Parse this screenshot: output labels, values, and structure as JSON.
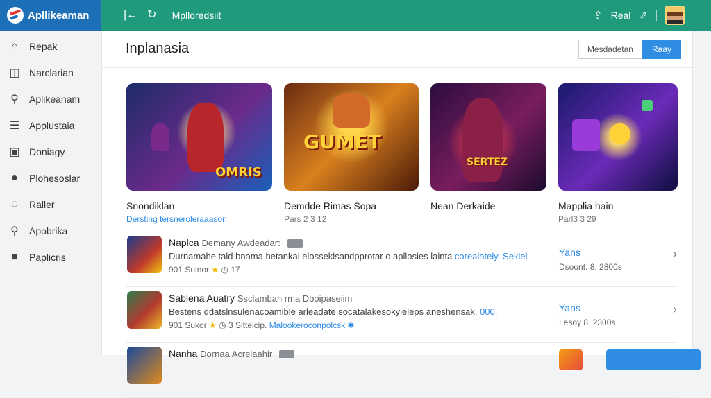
{
  "app": {
    "name": "Apllikeaman"
  },
  "topbar": {
    "title": "Mplloredsiit",
    "right_label": "Real"
  },
  "sidebar": {
    "items": [
      {
        "label": "Repak",
        "icon": "home-icon"
      },
      {
        "label": "Narclarian",
        "icon": "chart-icon"
      },
      {
        "label": "Aplikeanam",
        "icon": "search-icon"
      },
      {
        "label": "Applustaia",
        "icon": "list-icon"
      },
      {
        "label": "Doniagy",
        "icon": "wallet-icon"
      },
      {
        "label": "Plohesoslar",
        "icon": "user-icon"
      },
      {
        "label": "Raller",
        "icon": "chat-icon"
      },
      {
        "label": "Apobrika",
        "icon": "magnifier-icon"
      },
      {
        "label": "Paplicris",
        "icon": "lock-icon"
      }
    ]
  },
  "main": {
    "title": "Inplanasia",
    "secondary_button": "Mesdadetan",
    "primary_button": "Raay"
  },
  "cards": [
    {
      "name": "Snondiklan",
      "sub": "Dersting tersneroleraaason",
      "sub_is_link": true,
      "art_text": "OMRIS"
    },
    {
      "name": "Demdde Rimas Sopa",
      "sub": "Pars 2 3 12",
      "sub_is_link": false,
      "art_text": "GUMET"
    },
    {
      "name": "Nean Derkaide",
      "sub": "",
      "sub_is_link": false,
      "art_text": "SERTEZ"
    },
    {
      "name": "Mapplia hain",
      "sub": "Parl3 3 29",
      "sub_is_link": false,
      "art_text": ""
    }
  ],
  "rows": [
    {
      "title": "Naplca",
      "meta": "Demany Awdeadar:",
      "desc": "Durnamahe tald bnama hetankai elossekisandpprotar o apllosies lainta ",
      "desc_link": "corealately. Sekiel",
      "rating_text": "901 Sulnor",
      "rating_count": "17",
      "meta_link": "",
      "price": "Yans",
      "downloads": "Dsoont. 8. 2800s"
    },
    {
      "title": "Sablena Auatry",
      "meta": "Ssclamban rma Dboipaseiim",
      "desc": "Bestens ddatslnsulenacoamible arleadate socatalakesokyieleps aneshensak, ",
      "desc_link": "000.",
      "rating_text": "901 Sukor",
      "rating_count": "3 Sitteicip.",
      "meta_link": "Malookeroconpolcsk",
      "price": "Yans",
      "downloads": "Lesoy 8. 2300s"
    },
    {
      "title": "Nanha",
      "meta": "Dornaa Acrelaahir",
      "desc": "",
      "desc_link": "",
      "rating_text": "",
      "rating_count": "",
      "meta_link": "",
      "price": "",
      "downloads": ""
    }
  ],
  "colors": {
    "topbar": "#1f9a7c",
    "brand": "#1d6fb8",
    "accent": "#2f8de4"
  }
}
